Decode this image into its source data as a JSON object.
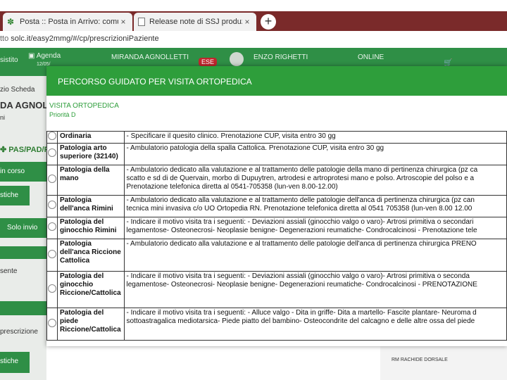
{
  "browser": {
    "tabs": [
      {
        "label": "Posta :: Posta in Arrivo: comuni",
        "close": "×"
      },
      {
        "label": "Release note di SSJ produzione",
        "close": "×"
      }
    ],
    "new_tab": "+",
    "url_prefix": "tto",
    "url_rest": "solc.it/easy2mmg/#/cp/prescrizioniPaziente"
  },
  "app": {
    "header": {
      "left": "sistito",
      "agenda": "Agenda",
      "agenda_date": "12/05/",
      "doctor": "MIRANDA AGNOLLETTI",
      "badge": "ESE",
      "patient": "ENZO RIGHETTI",
      "online": "ONLINE",
      "online_sub": "ONLINE"
    },
    "sidebar": {
      "scheda": "zio Scheda",
      "patient_short": "DA AGNOL",
      "patient_sub": "ni",
      "pas": "PAS/PAD/F",
      "in_corso": "in corso",
      "stiche": "stiche",
      "solo_invio": "Solo invio",
      "sente": "sente",
      "prescrizione": "prescrizione",
      "stiche2": "stiche"
    },
    "right_bg": "RM RACHIDE DORSALE"
  },
  "modal": {
    "title": "PERCORSO GUIDATO PER   VISITA ORTOPEDICA",
    "visit_name": "VISITA ORTOPEDICA",
    "priority": "Priorità D",
    "rows": [
      {
        "name": "Ordinaria",
        "desc": [
          "- Specificare il quesito clinico. Prenotazione CUP, visita entro 30 gg"
        ]
      },
      {
        "name": "Patologia arto superiore (32140)",
        "desc": [
          "- Ambulatorio patologia della spalla Cattolica. Prenotazione CUP, visita entro 30 gg"
        ]
      },
      {
        "name": "Patologia della mano",
        "desc": [
          "- Ambulatorio dedicato alla valutazione e al trattamento delle patologie della mano di pertinenza chirurgica (pz ca",
          "scatto e sd di de Quervain, morbo di Dupuytren, artrodesi e artroprotesi mano e polso. Artroscopie del polso e a",
          "Prenotazione telefonica diretta al 0541-705358 (lun-ven 8.00-12.00)"
        ]
      },
      {
        "name": "Patologia dell'anca Rimini",
        "desc": [
          "- Ambulatorio dedicato alla valutazione e al trattamento delle patologie dell'anca di pertinenza chirurgica (pz can",
          "tecnica mini invasiva c/o UO Ortopedia RN. Prenotazione telefonica diretta al 0541 705358 (lun-ven 8.00 12.00"
        ]
      },
      {
        "name": "Patologia del ginocchio Rimini",
        "desc": [
          "- Indicare il motivo visita tra i seguenti: - Deviazioni assiali (ginocchio valgo o varo)- Artrosi primitiva o secondari",
          "legamentose- Osteonecrosi- Neoplasie benigne- Degenerazioni reumatiche- Condrocalcinosi - Prenotazione tele"
        ]
      },
      {
        "name": "Patologia dell'anca Riccione Cattolica",
        "desc": [
          "- Ambulatorio dedicato alla valutazione e al trattamento delle patologie dell'anca di pertinenza chirurgica PRENO"
        ]
      },
      {
        "name": "Patologia del ginocchio Riccione/Cattolica",
        "desc": [
          "- Indicare il motivo visita tra i seguenti: - Deviazioni assiali (ginocchio valgo o varo)- Artrosi primitiva o seconda",
          "legamentose- Osteonecrosi- Neoplasie benigne- Degenerazioni reumatiche- Condrocalcinosi - PRENOTAZIONE"
        ]
      },
      {
        "name": "Patologia del piede Riccione/Cattolica",
        "desc": [
          "- Indicare il motivo visita tra i seguenti: - Alluce valgo - Dita in griffe- Dita a martello- Fascite plantare- Neuroma d",
          "sottoastragalica mediotarsica- Piede piatto del bambino- Osteocondrite del calcagno e delle altre ossa del piede"
        ]
      }
    ]
  }
}
